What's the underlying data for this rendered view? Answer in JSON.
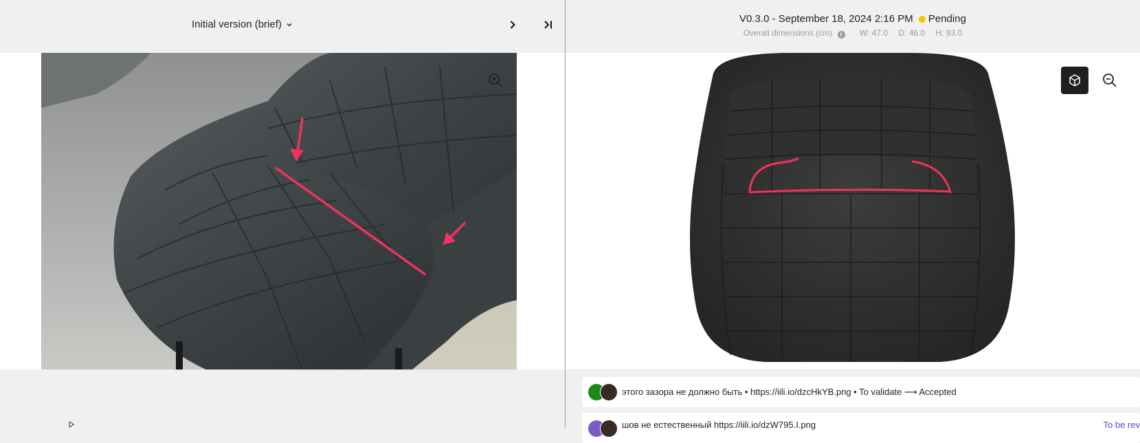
{
  "left": {
    "version_label": "Initial version (brief)",
    "icons": {
      "dropdown": "chevron-down-icon",
      "next": "chevron-right-icon",
      "last": "skip-to-end-icon",
      "zoom": "zoom-in-icon"
    }
  },
  "right": {
    "revision": "V0.3.0 - September 18, 2024 2:16 PM",
    "status": "Pending",
    "status_color": "#f5c400",
    "dims_label": "Overall dimensions (cm)",
    "width": "W: 47.0",
    "depth": "D: 46.0",
    "height": "H: 93.0",
    "icons": {
      "view3d": "cube-icon",
      "zoom": "zoom-out-icon",
      "info": "info-icon"
    }
  },
  "comments": [
    {
      "text": "этого зазора не должно быть • https://iili.io/dzcHkYB.png • To validate ⟶ Accepted"
    },
    {
      "text": "шов не естественный https://iili.io/dzW795.I.png",
      "status": "To be rev"
    }
  ],
  "colors": {
    "annotation": "#f0345c",
    "panel_bg": "#f0f0f0",
    "dark_button": "#1f1f1f"
  }
}
